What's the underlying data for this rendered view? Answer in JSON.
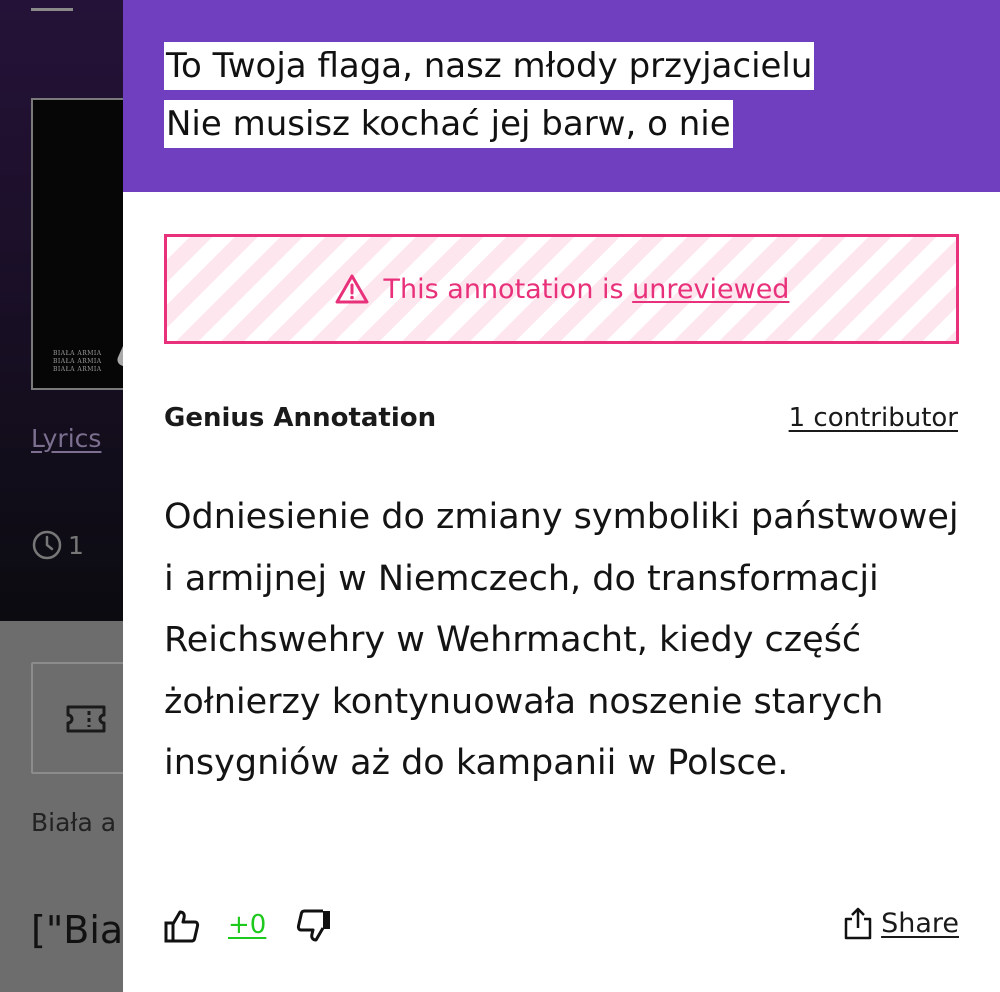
{
  "background": {
    "album_art_lines": [
      "BIAŁA ARMIA",
      "BIAŁA ARMIA",
      "BIAŁA ARMIA"
    ],
    "lyrics_link": "Lyrics",
    "pageview_count": "1",
    "artist_snippet": "Biała a",
    "title_snippet": "[\"Biał"
  },
  "annotation": {
    "quote_lines": [
      "To Twoja flaga, nasz młody przyjacielu",
      "Nie musisz kochać jej barw, o nie"
    ],
    "status_banner": {
      "prefix": "This annotation is ",
      "link": "unreviewed"
    },
    "source_label": "Genius Annotation",
    "contributors": "1 contributor",
    "body": "Odniesienie do zmiany symboliki państwowej i armijnej w Niemczech, do transformacji Reichswehry w Wehrmacht, kiedy część żołnierzy kontynuowała noszenie starych insygniów aż do kampanii w Polsce.",
    "votes": "+0",
    "share_label": "Share"
  },
  "colors": {
    "accent_purple": "#6f3fc0",
    "unreviewed_pink": "#e8317a",
    "vote_green": "#1ec91e"
  },
  "icons": [
    "menu-icon",
    "clock-icon",
    "ticket-icon",
    "warning-icon",
    "thumbs-up-icon",
    "thumbs-down-icon",
    "share-icon"
  ]
}
